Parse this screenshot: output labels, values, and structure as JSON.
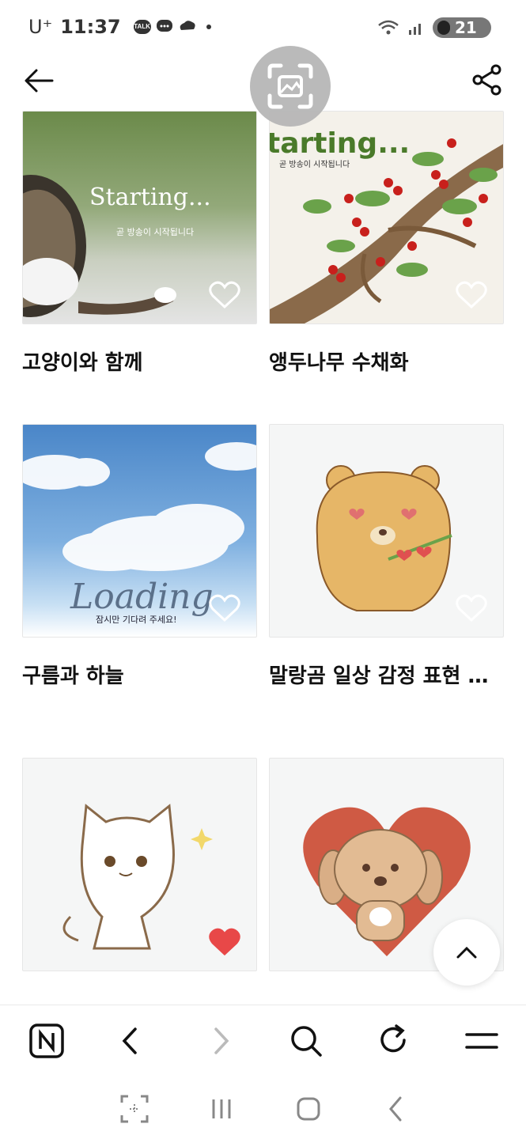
{
  "status_bar": {
    "carrier": "U⁺",
    "time": "11:37",
    "chip_label": "TALK",
    "battery": "21"
  },
  "items": [
    {
      "title": "고양이와 함께",
      "thumb_text": "Starting...",
      "thumb_sub": "곧 방송이 시작됩니다",
      "liked": false
    },
    {
      "title": "앵두나무 수채화",
      "thumb_text": "tarting...",
      "thumb_sub": "곧 방송이 시작됩니다",
      "liked": false
    },
    {
      "title": "구름과 하늘",
      "thumb_text": "Loading",
      "thumb_sub": "잠시만 기다려 주세요!",
      "liked": false
    },
    {
      "title": "말랑곰 일상 감정 표현 스...",
      "liked": false
    },
    {
      "title": "",
      "liked": true
    },
    {
      "title": "",
      "liked": false
    }
  ],
  "colors": {
    "heart_filled": "#e84848",
    "accent": "#333333"
  }
}
